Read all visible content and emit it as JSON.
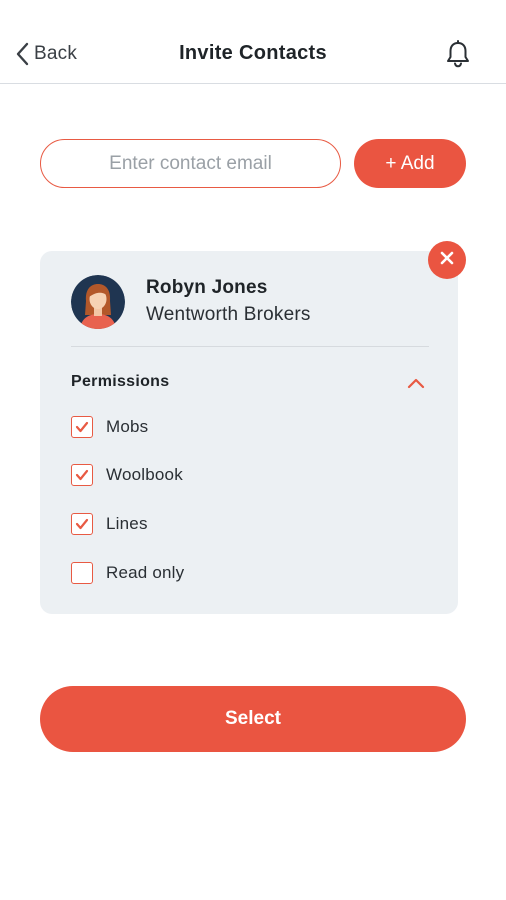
{
  "header": {
    "back_label": "Back",
    "title": "Invite Contacts",
    "back_icon": "chevron-left-icon",
    "notification_icon": "bell-icon"
  },
  "invite": {
    "email_placeholder": "Enter contact email",
    "email_value": "",
    "add_label": "+ Add"
  },
  "contact": {
    "name": "Robyn Jones",
    "company": "Wentworth Brokers",
    "remove_icon": "close-icon",
    "avatar_icon": "avatar-woman"
  },
  "permissions": {
    "title": "Permissions",
    "expanded": true,
    "items": [
      {
        "label": "Mobs",
        "checked": true
      },
      {
        "label": "Woolbook",
        "checked": true
      },
      {
        "label": "Lines",
        "checked": true
      },
      {
        "label": "Read only",
        "checked": false
      }
    ]
  },
  "actions": {
    "select_label": "Select"
  },
  "colors": {
    "accent": "#ea5541",
    "card_bg": "#ecf0f3",
    "text": "#1f2428"
  }
}
